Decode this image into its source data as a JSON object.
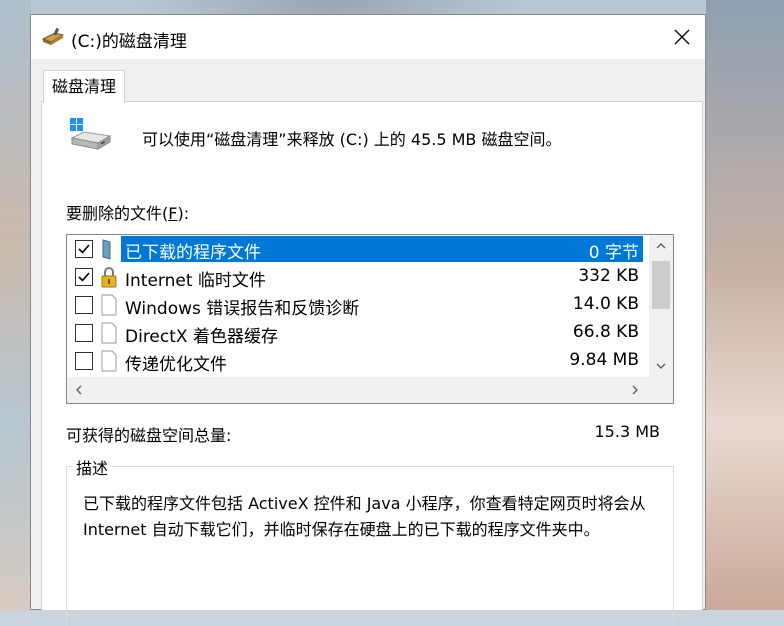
{
  "window": {
    "title": "(C:)的磁盘清理",
    "close_icon": "close-icon"
  },
  "tab": {
    "label": "磁盘清理"
  },
  "summary": {
    "text": "可以使用“磁盘清理”来释放 (C:) 上的 45.5 MB 磁盘空间。"
  },
  "files": {
    "label_pre": "要删除的文件(",
    "label_key": "F",
    "label_post": "):",
    "items": [
      {
        "name": "已下载的程序文件",
        "size": "0 字节",
        "checked": true,
        "selected": true,
        "icon": "folder-icon"
      },
      {
        "name": "Internet 临时文件",
        "size": "332 KB",
        "checked": true,
        "selected": false,
        "icon": "lock-icon"
      },
      {
        "name": "Windows 错误报告和反馈诊断",
        "size": "14.0 KB",
        "checked": false,
        "selected": false,
        "icon": "blank-file-icon"
      },
      {
        "name": "DirectX 着色器缓存",
        "size": "66.8 KB",
        "checked": false,
        "selected": false,
        "icon": "blank-file-icon"
      },
      {
        "name": "传递优化文件",
        "size": "9.84 MB",
        "checked": false,
        "selected": false,
        "icon": "blank-file-icon"
      }
    ]
  },
  "total": {
    "label": "可获得的磁盘空间总量:",
    "value": "15.3 MB"
  },
  "description": {
    "legend": "描述",
    "text": "已下载的程序文件包括 ActiveX 控件和 Java 小程序，你查看特定网页时将会从 Internet 自动下载它们，并临时保存在硬盘上的已下载的程序文件夹中。"
  },
  "colors": {
    "selection": "#0078d7",
    "window_bg": "#f0f0f0"
  }
}
